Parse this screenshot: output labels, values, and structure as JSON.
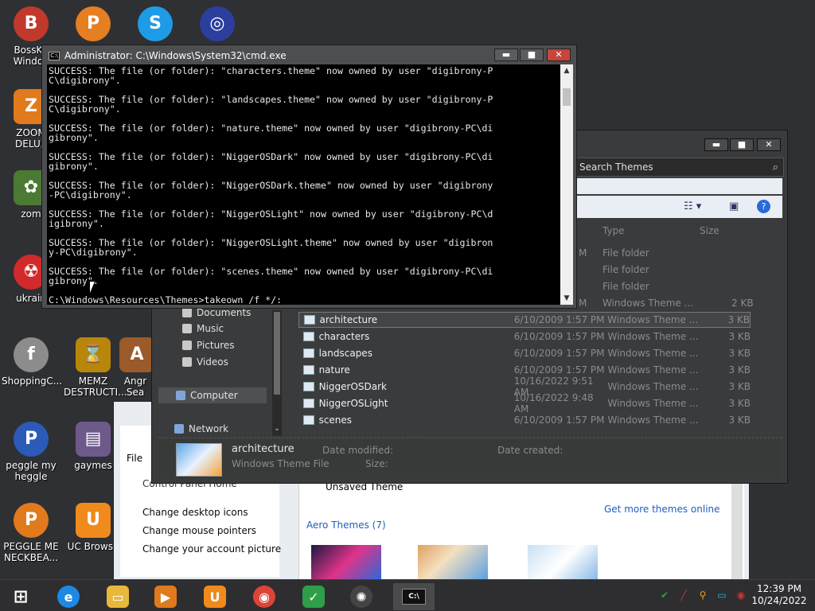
{
  "desktop": {
    "icons": [
      {
        "label": "BossKa Windov",
        "glyph": "B",
        "color": "#c0392b"
      },
      {
        "label": "",
        "glyph": "P",
        "color": "#e67e22"
      },
      {
        "label": "",
        "glyph": "S",
        "color": "#1e9be6"
      },
      {
        "label": "",
        "glyph": "◎",
        "color": "#2c3e9e"
      },
      {
        "label": "ZOOM DELUX",
        "glyph": "Z",
        "color": "#e07a1c"
      },
      {
        "label": "zom",
        "glyph": "✿",
        "color": "#4a7a33"
      },
      {
        "label": "ukrain",
        "glyph": "☢",
        "color": "#d22a2a"
      },
      {
        "label": "ShoppingC...",
        "glyph": "f",
        "color": "#8c8c8c"
      },
      {
        "label": "MEMZ DESTRUCTI...",
        "glyph": "⌛",
        "color": "#b8860b"
      },
      {
        "label": "Angr Sea",
        "glyph": "A",
        "color": "#9a5a2a"
      },
      {
        "label": "peggle my heggle",
        "glyph": "P",
        "color": "#2c5ab8"
      },
      {
        "label": "gaymes",
        "glyph": "▤",
        "color": "#6d5a8a"
      },
      {
        "label": "PEGGLE ME NECKBEA...",
        "glyph": "P",
        "color": "#e07a1c"
      },
      {
        "label": "UC Browse",
        "glyph": "U",
        "color": "#f08a1c"
      }
    ]
  },
  "cmd": {
    "title": "Administrator: C:\\Windows\\System32\\cmd.exe",
    "min": "▬",
    "max": "■",
    "close": "✕",
    "lines": [
      "SUCCESS: The file (or folder): \"characters.theme\" now owned by user \"digibrony-P",
      "C\\digibrony\".",
      "",
      "SUCCESS: The file (or folder): \"landscapes.theme\" now owned by user \"digibrony-P",
      "C\\digibrony\".",
      "",
      "SUCCESS: The file (or folder): \"nature.theme\" now owned by user \"digibrony-PC\\di",
      "gibrony\".",
      "",
      "SUCCESS: The file (or folder): \"NiggerOSDark\" now owned by user \"digibrony-PC\\di",
      "gibrony\".",
      "",
      "SUCCESS: The file (or folder): \"NiggerOSDark.theme\" now owned by user \"digibrony",
      "-PC\\digibrony\".",
      "",
      "SUCCESS: The file (or folder): \"NiggerOSLight\" now owned by user \"digibrony-PC\\d",
      "igibrony\".",
      "",
      "SUCCESS: The file (or folder): \"NiggerOSLight.theme\" now owned by user \"digibron",
      "y-PC\\digibrony\".",
      "",
      "SUCCESS: The file (or folder): \"scenes.theme\" now owned by user \"digibrony-PC\\di",
      "gibrony\".",
      "",
      "C:\\Windows\\Resources\\Themes>takeown /f */:_"
    ]
  },
  "explorer": {
    "min": "▬",
    "max": "■",
    "close": "✕",
    "search_placeholder": "Search Themes",
    "col_type": "Type",
    "col_size": "Size",
    "folders": [
      {
        "date": "M",
        "type": "File folder"
      },
      {
        "type": "File folder"
      },
      {
        "type": "File folder"
      }
    ],
    "partial_row": {
      "date": "M",
      "type": "Windows Theme ...",
      "size": "2 KB"
    },
    "nav": [
      "Documents",
      "Music",
      "Pictures",
      "Videos",
      "Computer",
      "Network"
    ],
    "files": [
      {
        "name": "architecture",
        "date": "6/10/2009 1:57 PM",
        "type": "Windows Theme ...",
        "size": "3 KB"
      },
      {
        "name": "characters",
        "date": "6/10/2009 1:57 PM",
        "type": "Windows Theme ...",
        "size": "3 KB"
      },
      {
        "name": "landscapes",
        "date": "6/10/2009 1:57 PM",
        "type": "Windows Theme ...",
        "size": "3 KB"
      },
      {
        "name": "nature",
        "date": "6/10/2009 1:57 PM",
        "type": "Windows Theme ...",
        "size": "3 KB"
      },
      {
        "name": "NiggerOSDark",
        "date": "10/16/2022 9:51 AM",
        "type": "Windows Theme ...",
        "size": "3 KB"
      },
      {
        "name": "NiggerOSLight",
        "date": "10/16/2022 9:48 AM",
        "type": "Windows Theme ...",
        "size": "3 KB"
      },
      {
        "name": "scenes",
        "date": "6/10/2009 1:57 PM",
        "type": "Windows Theme ...",
        "size": "3 KB"
      }
    ],
    "details": {
      "name": "architecture",
      "type": "Windows Theme File",
      "date_modified_label": "Date modified:",
      "size_label": "Size:",
      "date_created_label": "Date created:"
    }
  },
  "control_panel": {
    "file_menu": "File",
    "home_link": "Control Panel Home",
    "links": [
      "Change desktop icons",
      "Change mouse pointers",
      "Change your account picture"
    ],
    "unsaved_theme": "Unsaved Theme",
    "get_more": "Get more themes online",
    "aero_themes": "Aero Themes (7)"
  },
  "taskbar": {
    "apps": [
      {
        "name": "start",
        "glyph": "⊞",
        "color": "transparent"
      },
      {
        "name": "ie",
        "glyph": "e",
        "color": "#1e88e5"
      },
      {
        "name": "explorer",
        "glyph": "▭",
        "color": "#e8b83a"
      },
      {
        "name": "media",
        "glyph": "▶",
        "color": "#e07a1c"
      },
      {
        "name": "uc",
        "glyph": "U",
        "color": "#f08a1c"
      },
      {
        "name": "chrome",
        "glyph": "◉",
        "color": "#db4437"
      },
      {
        "name": "shield",
        "glyph": "✓",
        "color": "#2e9e48"
      },
      {
        "name": "color",
        "glyph": "✺",
        "color": "#444"
      },
      {
        "name": "cmd",
        "glyph": "C:\\",
        "color": "#111"
      }
    ],
    "time": "12:39 PM",
    "date": "10/24/2022"
  }
}
